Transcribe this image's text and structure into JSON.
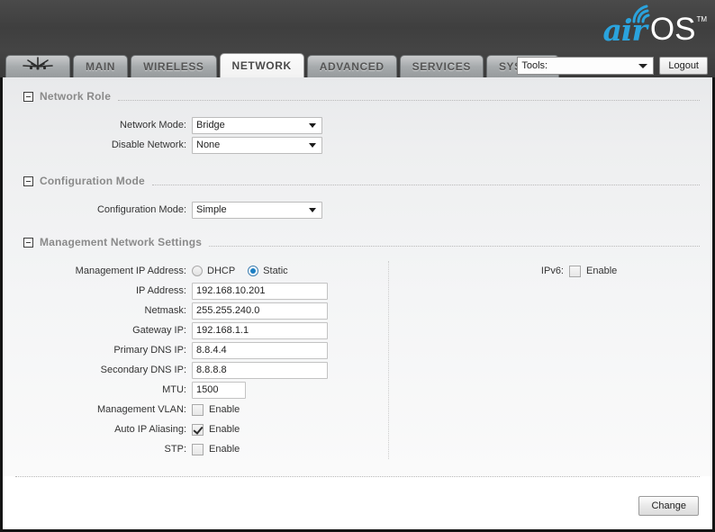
{
  "header": {
    "logo_air": "air",
    "logo_os": "OS",
    "logo_tm": "TM",
    "wave_icon": "signal-wave-icon"
  },
  "nav": {
    "brand_icon": "ubiquiti-logo-icon",
    "tabs": [
      {
        "label": "MAIN",
        "active": false
      },
      {
        "label": "WIRELESS",
        "active": false
      },
      {
        "label": "NETWORK",
        "active": true
      },
      {
        "label": "ADVANCED",
        "active": false
      },
      {
        "label": "SERVICES",
        "active": false
      },
      {
        "label": "SYSTEM",
        "active": false
      }
    ],
    "tools_label": "Tools:",
    "tools_arrow_icon": "chevron-down-icon",
    "logout_label": "Logout"
  },
  "sections": {
    "network_role": {
      "title": "Network Role",
      "collapse_icon": "minus-box-icon",
      "network_mode_label": "Network Mode:",
      "network_mode_value": "Bridge",
      "disable_network_label": "Disable Network:",
      "disable_network_value": "None"
    },
    "configuration_mode": {
      "title": "Configuration Mode",
      "collapse_icon": "minus-box-icon",
      "configuration_mode_label": "Configuration Mode:",
      "configuration_mode_value": "Simple"
    },
    "management_network": {
      "title": "Management Network Settings",
      "collapse_icon": "minus-box-icon",
      "mgmt_ip_label": "Management IP Address:",
      "dhcp_label": "DHCP",
      "static_label": "Static",
      "mgmt_ip_selected": "Static",
      "ip_address_label": "IP Address:",
      "ip_address_value": "192.168.10.201",
      "netmask_label": "Netmask:",
      "netmask_value": "255.255.240.0",
      "gateway_label": "Gateway IP:",
      "gateway_value": "192.168.1.1",
      "primary_dns_label": "Primary DNS IP:",
      "primary_dns_value": "8.8.4.4",
      "secondary_dns_label": "Secondary DNS IP:",
      "secondary_dns_value": "8.8.8.8",
      "mtu_label": "MTU:",
      "mtu_value": "1500",
      "mgmt_vlan_label": "Management VLAN:",
      "mgmt_vlan_enable": "Enable",
      "mgmt_vlan_checked": false,
      "auto_ip_label": "Auto IP Aliasing:",
      "auto_ip_enable": "Enable",
      "auto_ip_checked": true,
      "stp_label": "STP:",
      "stp_enable": "Enable",
      "stp_checked": false,
      "ipv6_label": "IPv6:",
      "ipv6_enable": "Enable",
      "ipv6_checked": false
    }
  },
  "footer": {
    "change_label": "Change"
  },
  "colors": {
    "header_bg": "#414141",
    "accent_blue": "#2aa3dd",
    "radio_blue": "#1b7fc4",
    "section_title": "#8a8a8a",
    "frame_border": "#141414"
  }
}
